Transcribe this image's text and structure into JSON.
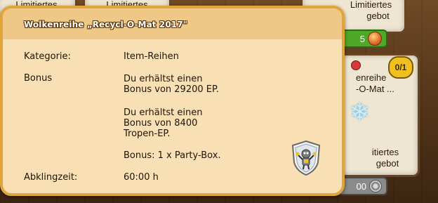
{
  "background": {
    "cards": [
      {
        "top_line": "Limitiertes",
        "bottom_line": ""
      },
      {
        "top_line": "Limitiertes",
        "bottom_line": ""
      },
      {
        "top_line": "Limitiertes",
        "bottom_line": "gebot"
      },
      {
        "top_line": "enreihe",
        "bottom_line": "-O-Mat ..."
      },
      {
        "top_line": "itiertes",
        "bottom_line": "gebot"
      }
    ],
    "price_green": "5",
    "price_grey": "00",
    "badge": "0/1"
  },
  "tooltip": {
    "title": "Wolkenreihe „Recycl-O-Mat 2017\"",
    "rows": [
      {
        "label": "Kategorie:",
        "value_lines": [
          "Item-Reihen"
        ]
      },
      {
        "label": "Bonus",
        "value_lines": [
          "Du erhältst einen",
          "Bonus von 29200 EP.",
          "Du erhältst einen",
          "Bonus von 8400",
          "Tropen-EP.",
          "Bonus: 1 x Party-Box."
        ]
      },
      {
        "label": "Abklingzeit:",
        "value_lines": [
          "60:00 h"
        ]
      }
    ],
    "icon": "shield-robot-icon"
  },
  "colors": {
    "tooltip_bg": "#f8e0b4",
    "tooltip_border": "#e2a53c",
    "header_bg": "#efc888",
    "green_price": "#4fa82a",
    "grey_price": "#8a8a8a",
    "badge": "#f0c020"
  }
}
